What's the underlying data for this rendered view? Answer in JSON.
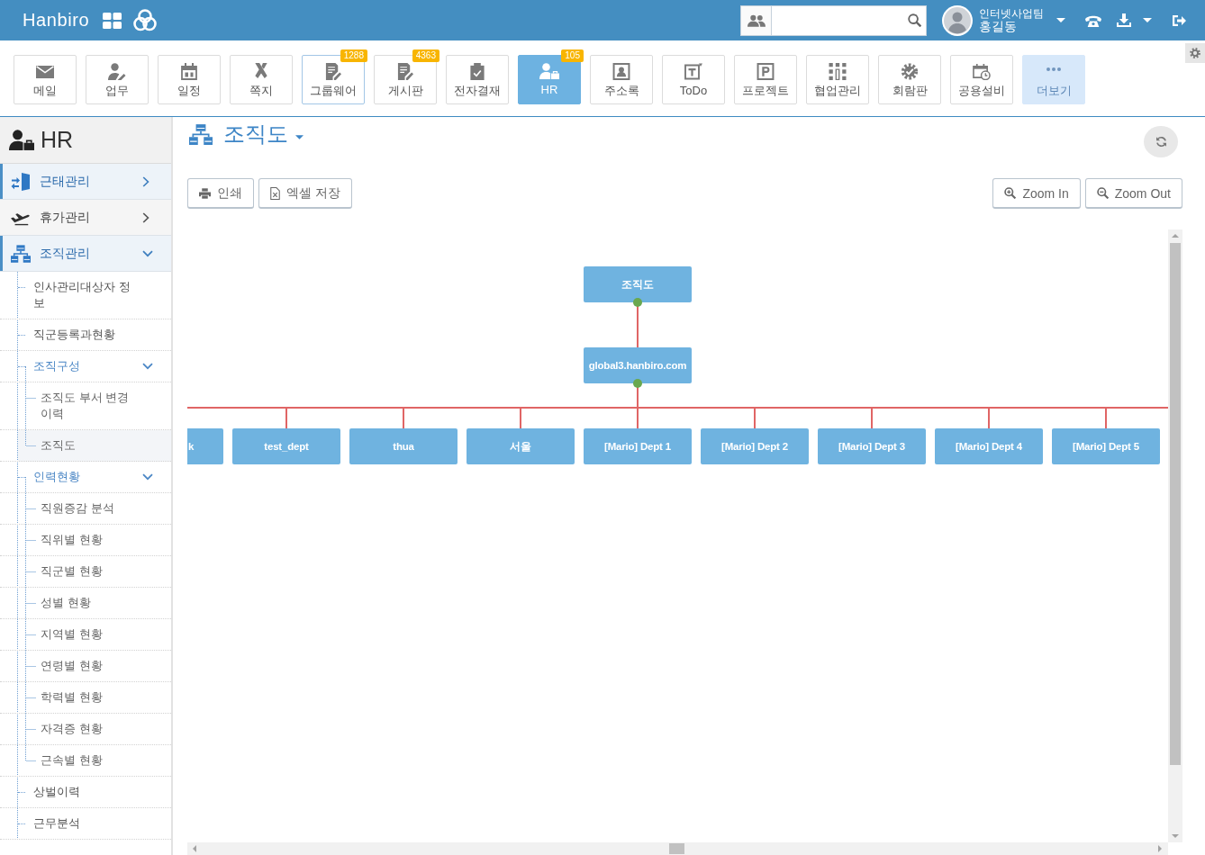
{
  "top_bar": {
    "logo": "Hanbiro",
    "user": {
      "team": "인터넷사업팀",
      "name": "홍길동"
    }
  },
  "toolbar": {
    "apps": [
      {
        "label": "메일",
        "kind": "app",
        "selected": false,
        "highlighted": false
      },
      {
        "label": "업무",
        "kind": "app",
        "selected": false,
        "highlighted": false
      },
      {
        "label": "일정",
        "kind": "app",
        "selected": false,
        "highlighted": false
      },
      {
        "label": "쪽지",
        "kind": "app",
        "selected": false,
        "highlighted": false
      },
      {
        "label": "그룹웨어",
        "kind": "app",
        "selected": false,
        "highlighted": true,
        "badge": "1288"
      },
      {
        "label": "게시판",
        "kind": "app",
        "selected": false,
        "highlighted": false,
        "badge": "4363"
      },
      {
        "label": "전자결재",
        "kind": "app",
        "selected": false,
        "highlighted": false
      },
      {
        "label": "HR",
        "kind": "app",
        "selected": true,
        "highlighted": false,
        "badge": "105"
      },
      {
        "label": "주소록",
        "kind": "app",
        "selected": false,
        "highlighted": false
      },
      {
        "label": "ToDo",
        "kind": "app",
        "selected": false,
        "highlighted": false
      },
      {
        "label": "프로젝트",
        "kind": "app",
        "selected": false,
        "highlighted": false
      },
      {
        "label": "협업관리",
        "kind": "app",
        "selected": false,
        "highlighted": false
      },
      {
        "label": "회람판",
        "kind": "app",
        "selected": false,
        "highlighted": false
      },
      {
        "label": "공용설비",
        "kind": "app",
        "selected": false,
        "highlighted": false
      },
      {
        "label": "더보기",
        "kind": "more",
        "selected": false,
        "highlighted": false
      }
    ]
  },
  "sidebar": {
    "title": "HR",
    "menu": [
      {
        "label": "근태관리",
        "highlighted": true,
        "expanded": false
      },
      {
        "label": "휴가관리",
        "highlighted": false,
        "expanded": false
      },
      {
        "label": "조직관리",
        "highlighted": true,
        "expanded": true,
        "children": [
          {
            "label": "인사관리대상자 정보",
            "selected": false
          },
          {
            "label": "직군등록과현황",
            "selected": false
          },
          {
            "label": "조직구성",
            "selected": false,
            "expanded": true,
            "children": [
              {
                "label": "조직도 부서 변경 이력",
                "selected": false
              },
              {
                "label": "조직도",
                "selected": true
              }
            ]
          },
          {
            "label": "인력현황",
            "selected": false,
            "expanded": true,
            "children": [
              {
                "label": "직원증감 분석",
                "selected": false
              },
              {
                "label": "직위별 현황",
                "selected": false
              },
              {
                "label": "직군별 현황",
                "selected": false
              },
              {
                "label": "성별 현황",
                "selected": false
              },
              {
                "label": "지역별 현황",
                "selected": false
              },
              {
                "label": "연령별 현황",
                "selected": false
              },
              {
                "label": "학력별 현황",
                "selected": false
              },
              {
                "label": "자격증 현황",
                "selected": false
              },
              {
                "label": "근속별 현황",
                "selected": false
              }
            ]
          },
          {
            "label": "상벌이력",
            "selected": false
          },
          {
            "label": "근무분석",
            "selected": false
          }
        ]
      }
    ]
  },
  "content": {
    "title": "조직도",
    "actions": [
      {
        "label": "인쇄"
      },
      {
        "label": "엑셀 저장"
      }
    ],
    "zoom_buttons": [
      {
        "label": "Zoom In"
      },
      {
        "label": "Zoom Out"
      }
    ],
    "org_chart": {
      "root": {
        "label": "조직도",
        "children": [
          {
            "label": "global3.hanbiro.com",
            "children": [
              {
                "label": "k",
                "kind": "cut"
              },
              {
                "label": "test_dept",
                "kind": "node"
              },
              {
                "label": "thua",
                "kind": "node"
              },
              {
                "label": "서울",
                "kind": "node"
              },
              {
                "label": "[Mario] Dept 1",
                "kind": "node"
              },
              {
                "label": "[Mario] Dept 2",
                "kind": "node"
              },
              {
                "label": "[Mario] Dept 3",
                "kind": "node"
              },
              {
                "label": "[Mario] Dept 4",
                "kind": "node"
              },
              {
                "label": "[Mario] Dept 5",
                "kind": "node"
              }
            ]
          }
        ]
      }
    }
  }
}
